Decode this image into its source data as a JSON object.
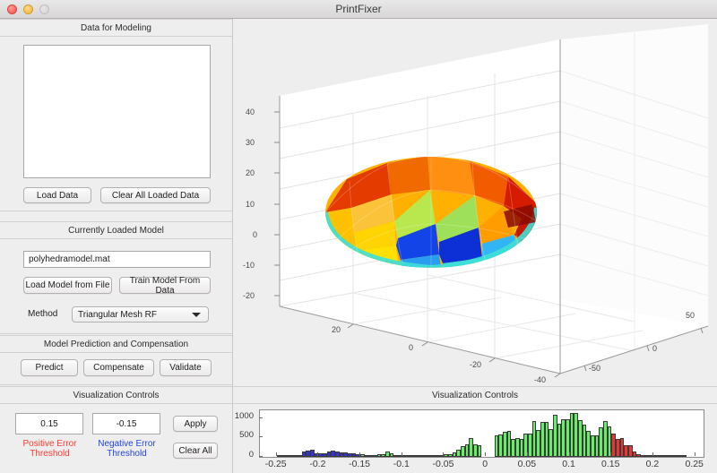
{
  "window": {
    "title": "PrintFixer",
    "controls": [
      "close",
      "minimize",
      "zoom"
    ]
  },
  "panels": {
    "data_for_modeling": {
      "title": "Data for Modeling",
      "listbox_value": "",
      "load_data_label": "Load Data",
      "clear_all_loaded_data_label": "Clear All Loaded Data"
    },
    "currently_loaded_model": {
      "title": "Currently Loaded Model",
      "model_file_value": "polyhedramodel.mat",
      "load_model_label": "Load Model from File",
      "train_model_label": "Train Model From Data",
      "method_label": "Method",
      "method_value": "Triangular Mesh RF",
      "method_options": [
        "Triangular Mesh RF"
      ]
    },
    "model_prediction": {
      "title": "Model Prediction and Compensation",
      "predict_label": "Predict",
      "compensate_label": "Compensate",
      "validate_label": "Validate"
    },
    "visualization_controls_left": {
      "title": "Visualization Controls",
      "positive_threshold_value": "0.15",
      "positive_threshold_label_line1": "Positive Error",
      "positive_threshold_label_line2": "Threshold",
      "positive_threshold_color": "#ff3b30",
      "negative_threshold_value": "-0.15",
      "negative_threshold_label_line1": "Negative Error",
      "negative_threshold_label_line2": "Threshold",
      "negative_threshold_color": "#2244ee",
      "apply_label": "Apply",
      "clear_all_label": "Clear All"
    },
    "visualization_controls_right": {
      "title": "Visualization Controls"
    }
  },
  "chart_data": [
    {
      "type": "surface",
      "name": "3d-dome-mesh",
      "title": "",
      "xlabel": "",
      "ylabel": "",
      "zlabel": "",
      "xticks": [
        20,
        0,
        -20,
        -40
      ],
      "yticks": [
        -50,
        0,
        50
      ],
      "zticks": [
        40,
        30,
        20,
        10,
        0,
        -10,
        -20
      ],
      "xlim": [
        -40,
        40
      ],
      "ylim": [
        -50,
        50
      ],
      "zlim": [
        -25,
        45
      ],
      "grid": true,
      "colormap": "jet",
      "description": "Dome / hemispherical polyhedra mesh colored by error, red-orange on top, blue patch on front lower area, cyan rim"
    },
    {
      "type": "bar",
      "name": "error-histogram",
      "title": "",
      "xlabel": "",
      "ylabel": "",
      "xlim": [
        -0.27,
        0.26
      ],
      "ylim": [
        0,
        1200
      ],
      "xticks": [
        -0.25,
        -0.2,
        -0.15,
        -0.1,
        -0.05,
        0,
        0.05,
        0.1,
        0.15,
        0.2,
        0.25
      ],
      "xticklabels": [
        "-0.25",
        "-0.2",
        "-0.15",
        "-0.1",
        "-0.05",
        "0",
        "0.05",
        "0.1",
        "0.15",
        "0.2",
        "0.25"
      ],
      "yticks": [
        0,
        500,
        1000
      ],
      "yticklabels": [
        "0",
        "500",
        "1000"
      ],
      "grid": false,
      "bin_width": 0.005,
      "colors": {
        "negative": "#3333dd",
        "neutral": "#66ee66",
        "positive": "#ee3333"
      },
      "negative_threshold": -0.15,
      "positive_threshold": 0.15,
      "bins": [
        {
          "x": -0.25,
          "v": 2
        },
        {
          "x": -0.245,
          "v": 3
        },
        {
          "x": -0.24,
          "v": 6
        },
        {
          "x": -0.235,
          "v": 30
        },
        {
          "x": -0.23,
          "v": 42
        },
        {
          "x": -0.225,
          "v": 55
        },
        {
          "x": -0.22,
          "v": 130
        },
        {
          "x": -0.215,
          "v": 160
        },
        {
          "x": -0.21,
          "v": 175
        },
        {
          "x": -0.205,
          "v": 100
        },
        {
          "x": -0.2,
          "v": 92
        },
        {
          "x": -0.195,
          "v": 95
        },
        {
          "x": -0.19,
          "v": 150
        },
        {
          "x": -0.185,
          "v": 160
        },
        {
          "x": -0.18,
          "v": 150
        },
        {
          "x": -0.175,
          "v": 125
        },
        {
          "x": -0.17,
          "v": 120
        },
        {
          "x": -0.165,
          "v": 92
        },
        {
          "x": -0.16,
          "v": 88
        },
        {
          "x": -0.155,
          "v": 80
        },
        {
          "x": -0.15,
          "v": 78
        },
        {
          "x": -0.145,
          "v": 40
        },
        {
          "x": -0.14,
          "v": 20
        },
        {
          "x": -0.135,
          "v": 18
        },
        {
          "x": -0.13,
          "v": 60
        },
        {
          "x": -0.125,
          "v": 80
        },
        {
          "x": -0.12,
          "v": 150
        },
        {
          "x": -0.115,
          "v": 98
        },
        {
          "x": -0.11,
          "v": 55
        },
        {
          "x": -0.105,
          "v": 42
        },
        {
          "x": -0.1,
          "v": 42
        },
        {
          "x": -0.095,
          "v": 38
        },
        {
          "x": -0.09,
          "v": 36
        },
        {
          "x": -0.085,
          "v": 55
        },
        {
          "x": -0.08,
          "v": 30
        },
        {
          "x": -0.075,
          "v": 25
        },
        {
          "x": -0.07,
          "v": 22
        },
        {
          "x": -0.065,
          "v": 28
        },
        {
          "x": -0.06,
          "v": 30
        },
        {
          "x": -0.055,
          "v": 58
        },
        {
          "x": -0.05,
          "v": 60
        },
        {
          "x": -0.045,
          "v": 78
        },
        {
          "x": -0.04,
          "v": 120
        },
        {
          "x": -0.035,
          "v": 180
        },
        {
          "x": -0.03,
          "v": 270
        },
        {
          "x": -0.025,
          "v": 330
        },
        {
          "x": -0.02,
          "v": 480
        },
        {
          "x": -0.015,
          "v": 318
        },
        {
          "x": -0.01,
          "v": 300
        },
        {
          "x": -0.005,
          "v": 0
        },
        {
          "x": 0.0,
          "v": 0
        },
        {
          "x": 0.005,
          "v": 0
        },
        {
          "x": 0.01,
          "v": 560
        },
        {
          "x": 0.015,
          "v": 580
        },
        {
          "x": 0.02,
          "v": 655
        },
        {
          "x": 0.025,
          "v": 670
        },
        {
          "x": 0.03,
          "v": 470
        },
        {
          "x": 0.035,
          "v": 495
        },
        {
          "x": 0.04,
          "v": 470
        },
        {
          "x": 0.045,
          "v": 600
        },
        {
          "x": 0.05,
          "v": 610
        },
        {
          "x": 0.055,
          "v": 920
        },
        {
          "x": 0.06,
          "v": 700
        },
        {
          "x": 0.065,
          "v": 905
        },
        {
          "x": 0.07,
          "v": 900
        },
        {
          "x": 0.075,
          "v": 705
        },
        {
          "x": 0.08,
          "v": 1095
        },
        {
          "x": 0.085,
          "v": 860
        },
        {
          "x": 0.09,
          "v": 975
        },
        {
          "x": 0.095,
          "v": 960
        },
        {
          "x": 0.1,
          "v": 1120
        },
        {
          "x": 0.105,
          "v": 1130
        },
        {
          "x": 0.11,
          "v": 935
        },
        {
          "x": 0.115,
          "v": 840
        },
        {
          "x": 0.12,
          "v": 680
        },
        {
          "x": 0.125,
          "v": 545
        },
        {
          "x": 0.13,
          "v": 560
        },
        {
          "x": 0.135,
          "v": 760
        },
        {
          "x": 0.14,
          "v": 930
        },
        {
          "x": 0.145,
          "v": 790
        },
        {
          "x": 0.15,
          "v": 610
        },
        {
          "x": 0.155,
          "v": 460
        },
        {
          "x": 0.16,
          "v": 485
        },
        {
          "x": 0.165,
          "v": 290
        },
        {
          "x": 0.17,
          "v": 300
        },
        {
          "x": 0.175,
          "v": 150
        },
        {
          "x": 0.18,
          "v": 60
        },
        {
          "x": 0.185,
          "v": 28
        },
        {
          "x": 0.19,
          "v": 12
        },
        {
          "x": 0.195,
          "v": 8
        },
        {
          "x": 0.2,
          "v": 20
        },
        {
          "x": 0.205,
          "v": 10
        },
        {
          "x": 0.21,
          "v": 22
        },
        {
          "x": 0.215,
          "v": 40
        },
        {
          "x": 0.22,
          "v": 52
        },
        {
          "x": 0.225,
          "v": 48
        },
        {
          "x": 0.23,
          "v": 30
        },
        {
          "x": 0.235,
          "v": 8
        }
      ]
    }
  ]
}
